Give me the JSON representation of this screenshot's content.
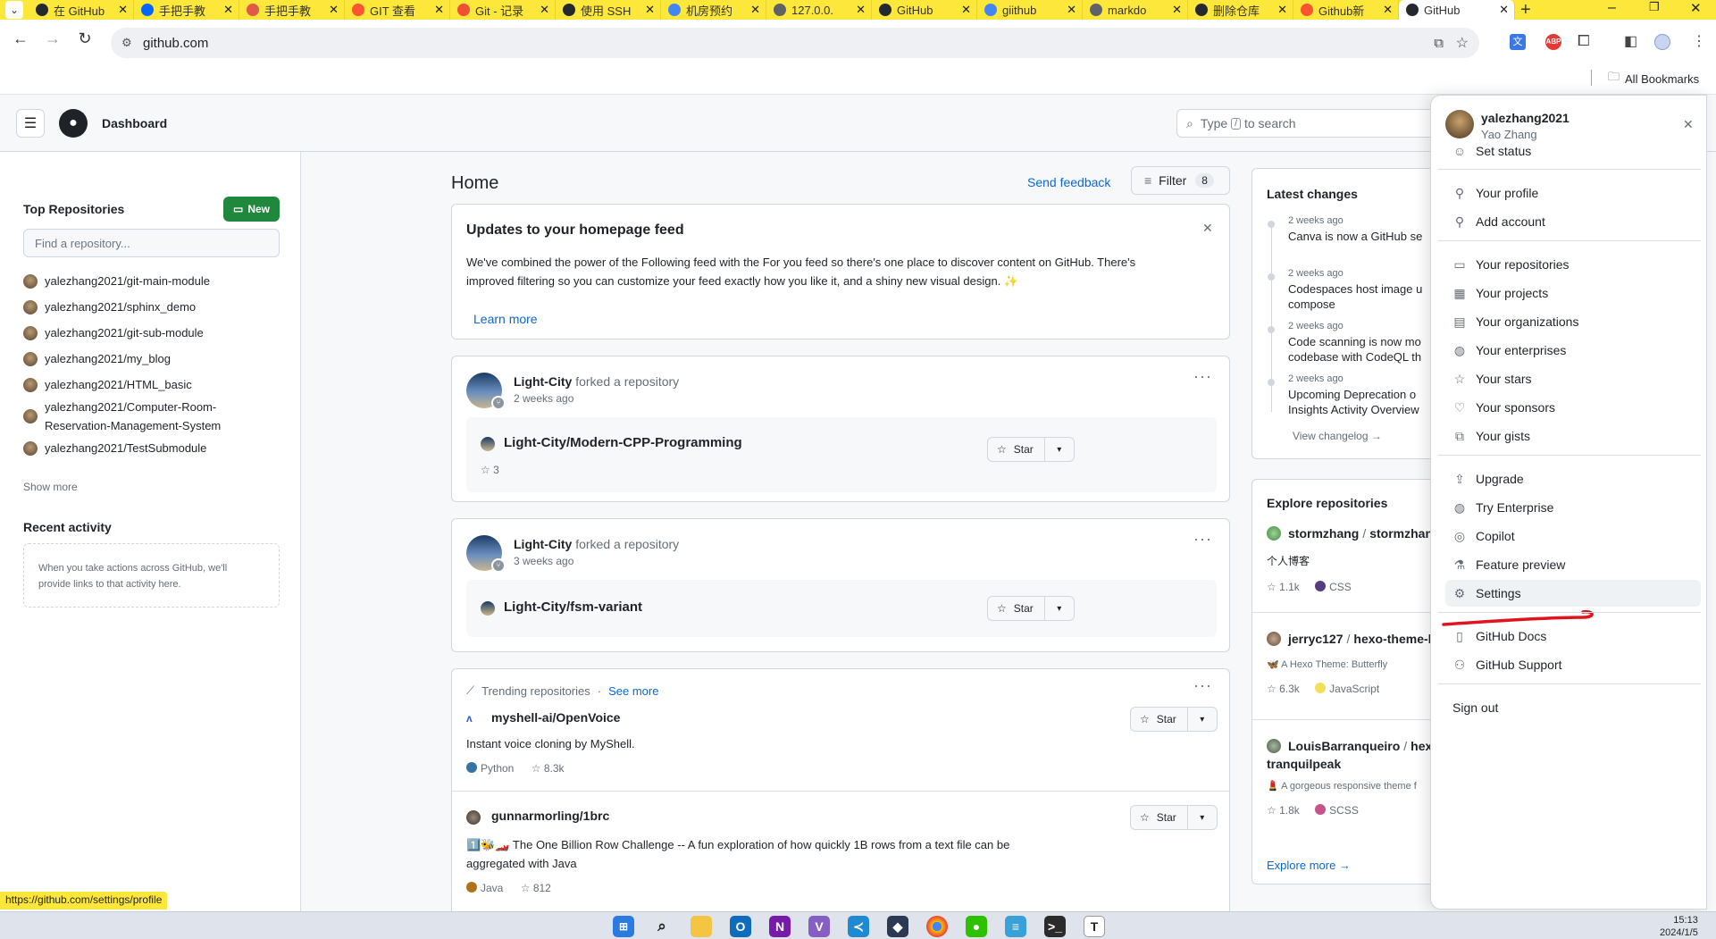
{
  "browser": {
    "tabs": [
      {
        "label": "在 GitHub",
        "icon": "github-icon",
        "color": "#24292f"
      },
      {
        "label": "手把手教",
        "icon": "zhihu-icon",
        "color": "#0066ff"
      },
      {
        "label": "手把手教",
        "icon": "site-icon",
        "color": "#e05a47"
      },
      {
        "label": "GIT 查看",
        "icon": "csdn-icon",
        "color": "#fc5531"
      },
      {
        "label": "Git - 记录",
        "icon": "git-icon",
        "color": "#f05033"
      },
      {
        "label": "使用 SSH",
        "icon": "github-icon",
        "color": "#24292f"
      },
      {
        "label": "机房预约",
        "icon": "google-icon",
        "color": "#4285f4"
      },
      {
        "label": "127.0.0.",
        "icon": "globe-icon",
        "color": "#5f6368"
      },
      {
        "label": "GitHub",
        "icon": "github-icon",
        "color": "#24292f"
      },
      {
        "label": "giithub",
        "icon": "google-icon",
        "color": "#4285f4"
      },
      {
        "label": "markdo",
        "icon": "globe-icon",
        "color": "#5f6368"
      },
      {
        "label": "删除仓库",
        "icon": "github-icon",
        "color": "#24292f"
      },
      {
        "label": "Github新",
        "icon": "csdn-icon",
        "color": "#fc5531"
      },
      {
        "label": "GitHub",
        "icon": "github-icon",
        "color": "#24292f",
        "active": true
      }
    ],
    "url": "github.com",
    "bookmarks_label": "All Bookmarks",
    "status_url": "https://github.com/settings/profile"
  },
  "header": {
    "title": "Dashboard",
    "search_placeholder_pre": "Type",
    "search_placeholder_key": "/",
    "search_placeholder_post": "to search"
  },
  "sidebar": {
    "top_repos_title": "Top Repositories",
    "new_button": "New",
    "find_placeholder": "Find a repository...",
    "repos": [
      "yalezhang2021/git-main-module",
      "yalezhang2021/sphinx_demo",
      "yalezhang2021/git-sub-module",
      "yalezhang2021/my_blog",
      "yalezhang2021/HTML_basic",
      "yalezhang2021/Computer-Room-",
      "Reservation-Management-System",
      "yalezhang2021/TestSubmodule"
    ],
    "show_more": "Show more",
    "recent_title": "Recent activity",
    "recent_empty_1": "When you take actions across GitHub, we'll",
    "recent_empty_2": "provide links to that activity here."
  },
  "feed": {
    "home_title": "Home",
    "send_feedback": "Send feedback",
    "filter_label": "Filter",
    "filter_count": "8",
    "updates": {
      "title": "Updates to your homepage feed",
      "line1": "We've combined the power of the Following feed with the For you feed so there's one place to discover content on GitHub. There's",
      "line2": "improved filtering so you can customize your feed exactly how you like it, and a shiny new visual design. ✨",
      "learn_more": "Learn more"
    },
    "fork1": {
      "user": "Light-City",
      "action": "forked a repository",
      "time": "2 weeks ago",
      "repo": "Light-City/Modern-CPP-Programming",
      "stars": "3",
      "star_label": "Star"
    },
    "fork2": {
      "user": "Light-City",
      "action": "forked a repository",
      "time": "3 weeks ago",
      "repo": "Light-City/fsm-variant",
      "star_label": "Star"
    },
    "trending": {
      "title": "Trending repositories",
      "see_more": "See more",
      "repo1": {
        "name": "myshell-ai/OpenVoice",
        "desc": "Instant voice cloning by MyShell.",
        "lang": "Python",
        "lang_color": "#3572A5",
        "stars": "8.3k",
        "star_label": "Star"
      },
      "repo2": {
        "name": "gunnarmorling/1brc",
        "desc1": "1️⃣🐝🏎️ The One Billion Row Challenge -- A fun exploration of how quickly 1B rows from a text file can be",
        "desc2": "aggregated with Java",
        "lang": "Java",
        "lang_color": "#b07219",
        "stars": "812",
        "star_label": "Star"
      }
    }
  },
  "right": {
    "latest_title": "Latest changes",
    "changes": [
      {
        "time": "2 weeks ago",
        "text1": "Canva is now a GitHub se",
        "text2": ""
      },
      {
        "time": "2 weeks ago",
        "text1": "Codespaces host image u",
        "text2": "compose"
      },
      {
        "time": "2 weeks ago",
        "text1": "Code scanning is now mo",
        "text2": "codebase with CodeQL th"
      },
      {
        "time": "2 weeks ago",
        "text1": "Upcoming Deprecation o",
        "text2": "Insights Activity Overview"
      }
    ],
    "view_changelog": "View changelog →",
    "explore_title": "Explore repositories",
    "explore": [
      {
        "owner": "stormzhang",
        "repo": "stormzhang",
        "desc": "个人博客",
        "stars": "1.1k",
        "lang": "CSS",
        "lang_color": "#563d7c"
      },
      {
        "owner": "jerryc127",
        "repo": "hexo-theme-b",
        "desc": "🦋 A Hexo Theme: Butterfly",
        "stars": "6.3k",
        "lang": "JavaScript",
        "lang_color": "#f1e05a"
      },
      {
        "owner": "LouisBarranqueiro",
        "repo": "hexo-",
        "repo2": "tranquilpeak",
        "desc": "💄 A gorgeous responsive theme f",
        "stars": "1.8k",
        "lang": "SCSS",
        "lang_color": "#c6538c"
      }
    ],
    "explore_more": "Explore more →"
  },
  "menu": {
    "username": "yalezhang2021",
    "fullname": "Yao Zhang",
    "items": {
      "set_status": "Set status",
      "your_profile": "Your profile",
      "add_account": "Add account",
      "your_repositories": "Your repositories",
      "your_projects": "Your projects",
      "your_organizations": "Your organizations",
      "your_enterprises": "Your enterprises",
      "your_stars": "Your stars",
      "your_sponsors": "Your sponsors",
      "your_gists": "Your gists",
      "upgrade": "Upgrade",
      "try_enterprise": "Try Enterprise",
      "copilot": "Copilot",
      "feature_preview": "Feature preview",
      "settings": "Settings",
      "github_docs": "GitHub Docs",
      "github_support": "GitHub Support",
      "sign_out": "Sign out"
    }
  },
  "taskbar": {
    "time": "15:13",
    "date": "2024/1/5"
  }
}
